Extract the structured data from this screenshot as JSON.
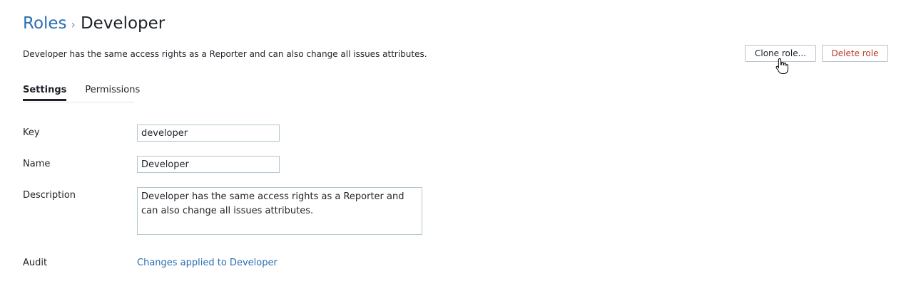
{
  "breadcrumb": {
    "parent": "Roles",
    "separator": "›",
    "current": "Developer"
  },
  "role": {
    "description_text": "Developer has the same access rights as a Reporter and can also change all issues attributes."
  },
  "actions": {
    "clone_label": "Clone role...",
    "delete_label": "Delete role"
  },
  "tabs": [
    {
      "label": "Settings",
      "active": true
    },
    {
      "label": "Permissions",
      "active": false
    }
  ],
  "form": {
    "key": {
      "label": "Key",
      "value": "developer"
    },
    "name": {
      "label": "Name",
      "value": "Developer"
    },
    "description": {
      "label": "Description",
      "value": "Developer has the same access rights as a Reporter and can also change all issues attributes."
    },
    "audit": {
      "label": "Audit",
      "link_text": "Changes applied to Developer"
    }
  },
  "colors": {
    "link": "#2a6eb2",
    "danger": "#c0392b",
    "border": "#b0c6cf"
  },
  "icons": {
    "cursor": "hand-pointer-cursor"
  }
}
